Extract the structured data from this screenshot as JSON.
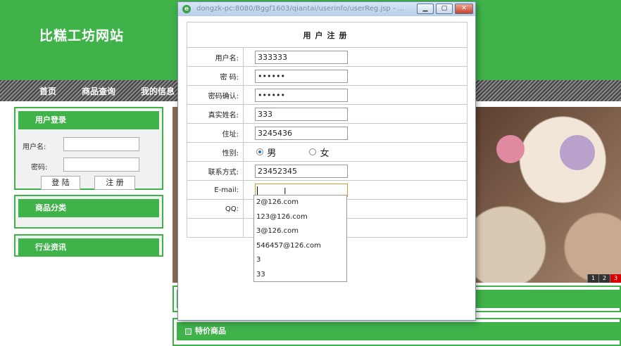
{
  "site": {
    "title": "比糕工坊网站"
  },
  "nav": {
    "items": [
      "首页",
      "商品查询",
      "我的信息"
    ]
  },
  "login_box": {
    "title": "用户登录",
    "username_label": "用户名:",
    "password_label": "密码:",
    "login_button": "登 陆",
    "register_button": "注 册"
  },
  "category_box": {
    "title": "商品分类"
  },
  "news_box": {
    "title": "行业资讯"
  },
  "banner": {
    "pages": [
      "1",
      "2",
      "3"
    ],
    "active_page": "3"
  },
  "special": {
    "title": "特价商品"
  },
  "popup": {
    "url": "dongzk-pc:8080/Bggf1603/qiantai/userinfo/userReg.jsp - ...",
    "form_title": "用户注册",
    "fields": [
      {
        "label": "用户名:",
        "value": "333333"
      },
      {
        "label": "密 码:",
        "value": "••••••"
      },
      {
        "label": "密码确认:",
        "value": "••••••"
      },
      {
        "label": "真实姓名:",
        "value": "333"
      },
      {
        "label": "住址:",
        "value": "3245436"
      }
    ],
    "gender": {
      "label": "性别:",
      "male": "男",
      "female": "女",
      "selected": "男"
    },
    "contact": {
      "label": "联系方式:",
      "value": "23452345"
    },
    "email": {
      "label": "E-mail:",
      "value": ""
    },
    "qq": {
      "label": "QQ:"
    },
    "autocomplete": [
      "2@126.com",
      "123@126.com",
      "3@126.com",
      "546457@126.com",
      "3",
      "33"
    ]
  },
  "colors": {
    "brand_green": "#3fb24a",
    "active_red": "#d60000"
  }
}
